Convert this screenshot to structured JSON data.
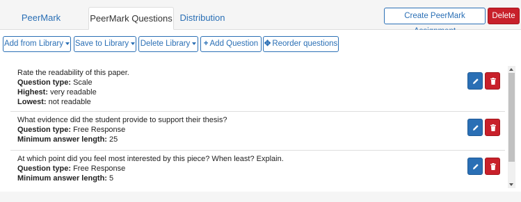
{
  "tabs": [
    {
      "label": "PeerMark Assignment",
      "active": false
    },
    {
      "label": "PeerMark Questions",
      "active": true
    },
    {
      "label": "Distribution",
      "active": false
    }
  ],
  "header_actions": {
    "create_label": "Create PeerMark Assignment",
    "delete_label": "Delete"
  },
  "toolbar": {
    "add_from_library": "Add from Library",
    "save_to_library": "Save to Library",
    "delete_library": "Delete Library",
    "add_question": "Add Question",
    "reorder_questions": "Reorder questions"
  },
  "questions": [
    {
      "text": "Rate the readability of this paper.",
      "fields": [
        {
          "label": "Question type:",
          "value": "Scale"
        },
        {
          "label": "Highest:",
          "value": "very readable"
        },
        {
          "label": "Lowest:",
          "value": "not readable"
        }
      ]
    },
    {
      "text": "What evidence did the student provide to support their thesis?",
      "fields": [
        {
          "label": "Question type:",
          "value": "Free Response"
        },
        {
          "label": "Minimum answer length:",
          "value": "25"
        }
      ]
    },
    {
      "text": "At which point did you feel most interested by this piece? When least? Explain.",
      "fields": [
        {
          "label": "Question type:",
          "value": "Free Response"
        },
        {
          "label": "Minimum answer length:",
          "value": "5"
        }
      ]
    }
  ],
  "colors": {
    "primary": "#2a6fb5",
    "danger": "#c8202a"
  }
}
